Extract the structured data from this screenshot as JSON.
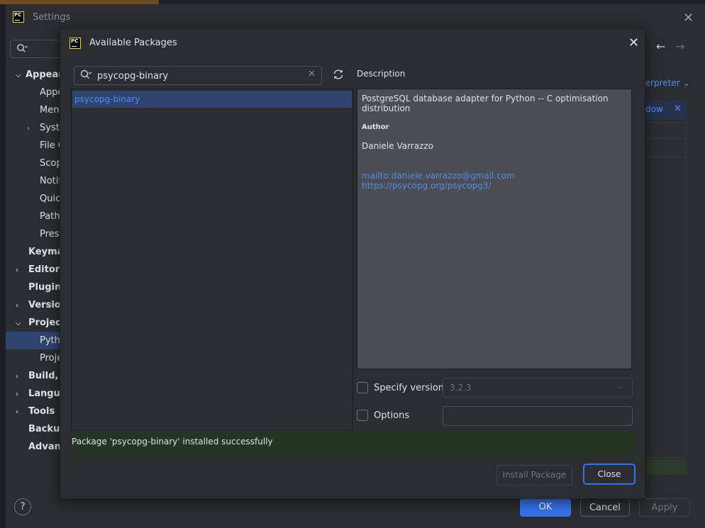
{
  "settings": {
    "title": "Settings",
    "close_glyph": "✕",
    "search_icon": "search-icon",
    "tree": [
      {
        "label": "Appearance",
        "bold": true,
        "chevron": "down"
      },
      {
        "label": "Appearance",
        "bold": false,
        "chevron": "none"
      },
      {
        "label": "Menus and Toolbars",
        "bold": false,
        "chevron": "none"
      },
      {
        "label": "System Settings",
        "bold": false,
        "chevron": "right"
      },
      {
        "label": "File Colors",
        "bold": false,
        "chevron": "none"
      },
      {
        "label": "Scopes",
        "bold": false,
        "chevron": "none"
      },
      {
        "label": "Notifications",
        "bold": false,
        "chevron": "none"
      },
      {
        "label": "Quick Lists",
        "bold": false,
        "chevron": "none"
      },
      {
        "label": "Path Variables",
        "bold": false,
        "chevron": "none"
      },
      {
        "label": "Presentation Assistant",
        "bold": false,
        "chevron": "none"
      },
      {
        "label": "Keymap",
        "bold": true,
        "chevron": "none"
      },
      {
        "label": "Editor",
        "bold": true,
        "chevron": "right"
      },
      {
        "label": "Plugins",
        "bold": true,
        "chevron": "none"
      },
      {
        "label": "Version Control",
        "bold": true,
        "chevron": "right"
      },
      {
        "label": "Project: ",
        "bold": true,
        "chevron": "down"
      },
      {
        "label": "Python Interpreter",
        "bold": false,
        "chevron": "none",
        "selected": true
      },
      {
        "label": "Project Structure",
        "bold": false,
        "chevron": "none"
      },
      {
        "label": "Build, Execution, Deployment",
        "bold": true,
        "chevron": "right"
      },
      {
        "label": "Languages & Frameworks",
        "bold": true,
        "chevron": "right"
      },
      {
        "label": "Tools",
        "bold": true,
        "chevron": "right"
      },
      {
        "label": "Backup and Sync",
        "bold": true,
        "chevron": "none"
      },
      {
        "label": "Advanced Settings",
        "bold": true,
        "chevron": "none"
      }
    ],
    "interpreter_link": "terpreter ⌄",
    "window_bar_text": "dow",
    "help": "?",
    "ok": "OK",
    "cancel": "Cancel",
    "apply": "Apply"
  },
  "dialog": {
    "title": "Available Packages",
    "close_glyph": "✕",
    "search_value": "psycopg-binary",
    "clear_glyph": "✕",
    "packages": [
      "psycopg-binary"
    ],
    "description_label": "Description",
    "description": {
      "summary": "PostgreSQL database adapter for Python -- C optimisation distribution",
      "author_heading": "Author",
      "author": "Daniele Varrazzo",
      "email_link": "mailto:daniele.varrazzo@gmail.com",
      "web_link": "https://psycopg.org/psycopg3/"
    },
    "specify_version_label": "Specify version",
    "version_value": "3.2.3",
    "options_label": "Options",
    "options_value": "",
    "status": "Package 'psycopg-binary' installed successfully",
    "install_button": "Install Package",
    "close_button": "Close"
  },
  "colors": {
    "accent": "#3574f0",
    "link": "#548af7",
    "selection": "#2e436e",
    "success_bg": "#253424"
  }
}
